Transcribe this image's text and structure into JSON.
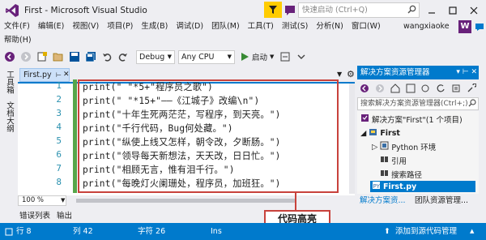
{
  "window": {
    "title": "First - Microsoft Visual Studio",
    "quick_launch_placeholder": "快速启动 (Ctrl+Q)"
  },
  "menu": {
    "row1": [
      "文件(F)",
      "编辑(E)",
      "视图(V)",
      "项目(P)",
      "生成(B)",
      "调试(D)",
      "团队(M)",
      "工具(T)",
      "测试(S)",
      "分析(N)",
      "窗口(W)"
    ],
    "row2": [
      "帮助(H)"
    ],
    "user_name": "wangxiaoke",
    "user_initial": "W"
  },
  "toolbar": {
    "config": "Debug",
    "platform": "Any CPU",
    "start_label": "启动"
  },
  "toolbox_strip": {
    "item1": "工具箱",
    "item2": "文档大纲"
  },
  "editor": {
    "tab_name": "First.py",
    "line_numbers": [
      "1",
      "2",
      "3",
      "4",
      "5",
      "6",
      "7",
      "8"
    ],
    "code_lines": [
      "print(\" \"*5+\"程序员之歌\")",
      "print(\" \"*15+\"——《江城子》改编\\n\")",
      "print(\"十年生死两茫茫，写程序，到天亮。\")",
      "print(\"千行代码，Bug何处藏。\")",
      "print(\"纵使上线又怎样，朝令改，夕断肠。\")",
      "print(\"领导每天新想法，天天改，日日忙。\")",
      "print(\"相顾无言，惟有泪千行。\")",
      "print(\"每晚灯火阑珊处，程序员，加班狂。\")"
    ],
    "zoom": "100 %",
    "callout": "代码高亮"
  },
  "bottom_tabs": [
    "错误列表",
    "输出"
  ],
  "statusbar": {
    "line": "行 8",
    "col": "列 42",
    "char": "字符 26",
    "mode": "Ins",
    "source_control": "添加到源代码管理"
  },
  "solution_explorer": {
    "title": "解决方案资源管理器",
    "search_placeholder": "搜索解决方案资源管理器(Ctrl+;)",
    "solution_label": "解决方案\"First\"(1 个项目)",
    "project_label": "First",
    "env_label": "Python 环境",
    "refs_label": "引用",
    "search_paths_label": "搜索路径",
    "file_label": "First.py",
    "tab1": "解决方案资...",
    "tab2": "团队资源管理..."
  },
  "colors": {
    "accent": "#007acc",
    "highlight_border": "#c8423c",
    "line_number": "#2b91af",
    "change_bar": "#57a64a"
  }
}
